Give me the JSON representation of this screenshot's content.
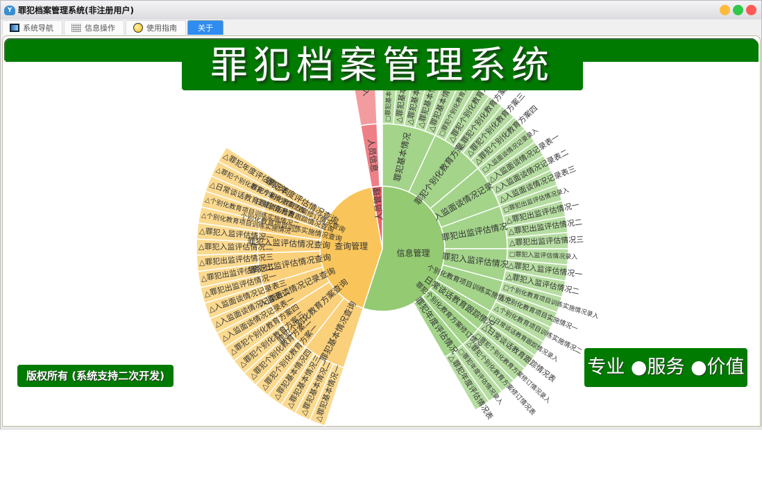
{
  "window": {
    "title": "罪犯档案管理系统(非注册用户)",
    "controls": [
      {
        "name": "minimize",
        "color": "#fdbb3b"
      },
      {
        "name": "maximize",
        "color": "#2fc84a"
      },
      {
        "name": "close",
        "color": "#fe5a55"
      }
    ]
  },
  "tabs": [
    {
      "label": "系统导航",
      "icon": "monitor-icon"
    },
    {
      "label": "信息操作",
      "icon": "grid-icon"
    },
    {
      "label": "使用指南",
      "icon": "help-bulb-icon"
    },
    {
      "label": "关于",
      "active": true
    }
  ],
  "header": {
    "title": "罪犯档案管理系统"
  },
  "footer": {
    "copyright": "版权所有 (系统支持二次开发)",
    "slogan": "专业 ●服务 ●价值"
  },
  "colors": {
    "brand": "#007a00",
    "green": [
      "#94ca72",
      "#a3d48a",
      "#b6dda1"
    ],
    "orange": [
      "#f9c55a",
      "#fad07b",
      "#fbda90"
    ],
    "red": [
      "#ea636b",
      "#ef7f86",
      "#f39ca0"
    ]
  },
  "chart_data": {
    "type": "sunburst",
    "leaf_value": 1,
    "roots": [
      {
        "name": "信息管理",
        "color": "green",
        "value": 39.6,
        "children": [
          {
            "name": "罪犯基本情况",
            "leaves": [
              "□罪犯基本情况录入",
              "△罪犯基本情况一",
              "△罪犯基本情况二",
              "△罪犯基本情况三",
              "△罪犯基本情况四"
            ]
          },
          {
            "name": "罪犯个别化教育方案",
            "leaves": [
              "□罪犯个别化教育方案录入",
              "△罪犯个别化教育方案一",
              "△罪犯个别化教育方案二",
              "△罪犯个别化教育方案三",
              "△罪犯个别化教育方案四"
            ]
          },
          {
            "name": "入监面谈情况记录",
            "leaves": [
              "□入监面谈情况记录录入",
              "△入监面谈情况记录表一",
              "△入监面谈情况记录表二",
              "△入监面谈情况记录表三"
            ]
          },
          {
            "name": "罪犯出监评估情况",
            "leaves": [
              "□罪犯出监评估情况录入",
              "△罪犯出监评估情况一",
              "△罪犯出监评估情况二",
              "△罪犯出监评估情况三"
            ]
          },
          {
            "name": "罪犯入监评估情况",
            "leaves": [
              "□罪犯入监评估情况录入",
              "△罪犯入监评估情况一",
              "△罪犯入监评估情况二"
            ]
          },
          {
            "name": "个别化教育项目训练实施情况",
            "leaves": [
              "□个别化教育项目训练实施情况录入",
              "△个别化教育项目实施情况一",
              "△个别化教育项目训练实施情况二"
            ]
          },
          {
            "name": "日常谈话教育跟踪情况",
            "leaves": [
              "□日常谈话教育跟踪情况录入",
              "△日常谈话教育跟踪情况表"
            ]
          },
          {
            "name": "罪犯个别化教育方案修订情况",
            "leaves": [
              "□罪犯个别化教育方案修订情况录入",
              "△罪犯个别化教育方案修订情况表"
            ]
          },
          {
            "name": "罪犯年度评估情况",
            "leaves": [
              "□罪犯年度评估情况录入",
              "△罪犯年度评估情况表"
            ]
          }
        ]
      },
      {
        "name": "查询管理",
        "color": "orange",
        "value": 30.4,
        "children": [
          {
            "name": "罪犯基本情况查询",
            "leaves": [
              "△罪犯基本情况一",
              "△罪犯基本情况二",
              "△罪犯基本情况三",
              "△罪犯基本情况四"
            ]
          },
          {
            "name": "罪犯个别化教育方案查询",
            "leaves": [
              "△罪犯个别化教育方案一",
              "△罪犯个别化教育方案二",
              "△罪犯个别化教育方案三",
              "△罪犯个别化教育方案四"
            ]
          },
          {
            "name": "入监面谈情况记录查询",
            "leaves": [
              "△入监面谈情况记录表一",
              "△入监面谈情况记录表二",
              "△入监面谈情况记录表三"
            ]
          },
          {
            "name": "罪犯出监评估情况查询",
            "leaves": [
              "△罪犯出监评估情况一",
              "△罪犯出监评估情况二",
              "△罪犯出监评估情况三"
            ]
          },
          {
            "name": "罪犯入监评估情况查询",
            "leaves": [
              "△罪犯入监评估情况二",
              "△罪犯入监评估情况一"
            ]
          },
          {
            "name": "个别化教育项目训练实施情况查询",
            "leaves": [
              "△个别化教育项目训练实施情况一",
              "△个别化教育项目训练实施情况二"
            ]
          },
          {
            "name": "日常谈话教育跟踪情况查询",
            "leaves": [
              "△日常谈话教育跟踪情况表"
            ]
          },
          {
            "name": "罪犯个别化教育方案修订情况查询",
            "leaves": [
              "△罪犯个别化教育方案修订情况表"
            ]
          },
          {
            "name": "罪犯年度评估情况查询",
            "leaves": [
              "△罪犯年度评估情况表"
            ]
          }
        ]
      },
      {
        "name": "人员管理",
        "color": "red",
        "value": 2,
        "children": [
          {
            "name": "人员信息",
            "value": 1.5,
            "leaves": [
              "人员录入"
            ]
          }
        ]
      }
    ]
  }
}
